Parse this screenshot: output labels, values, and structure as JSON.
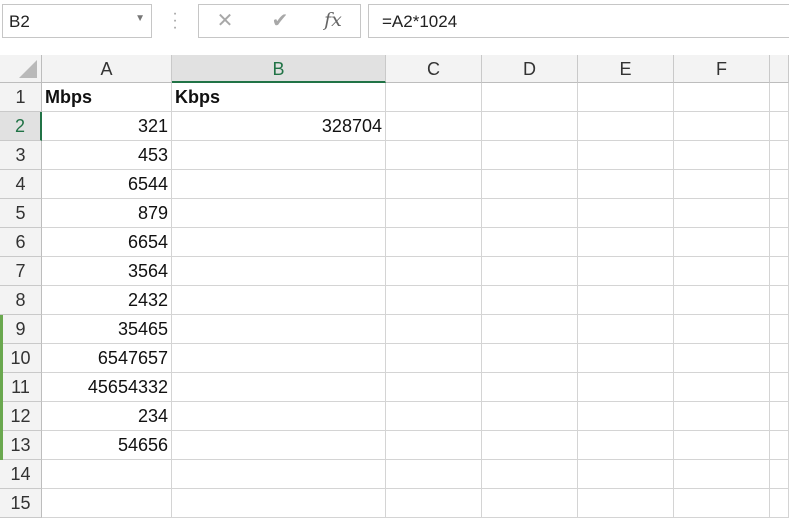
{
  "name_box": {
    "value": "B2"
  },
  "formula_bar": {
    "formula": "=A2*1024"
  },
  "toolbar_icons": [
    "cancel-icon",
    "enter-icon",
    "function-icon"
  ],
  "columns": [
    "A",
    "B",
    "C",
    "D",
    "E",
    "F"
  ],
  "rows": [
    "1",
    "2",
    "3",
    "4",
    "5",
    "6",
    "7",
    "8",
    "9",
    "10",
    "11",
    "12",
    "13",
    "14",
    "15"
  ],
  "cells": {
    "A1": "Mbps",
    "B1": "Kbps",
    "A2": "321",
    "B2": "328704",
    "A3": "453",
    "A4": "6544",
    "A5": "879",
    "A6": "6654",
    "A7": "3564",
    "A8": "2432",
    "A9": "35465",
    "A10": "6547657",
    "A11": "45654332",
    "A12": "234",
    "A13": "54656"
  },
  "selected_cell": "B2",
  "colors": {
    "accent": "#217346",
    "gridline": "#d4d4d4",
    "header_bg": "#f3f3f3"
  }
}
